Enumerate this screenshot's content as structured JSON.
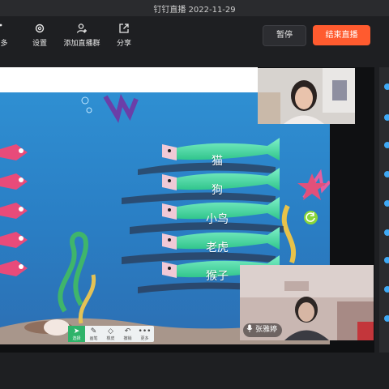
{
  "window": {
    "title": "钉钉直播 2022-11-29"
  },
  "toolbar": {
    "items": [
      {
        "label": "多",
        "icon": "more-icon"
      },
      {
        "label": "设置",
        "icon": "gear-icon"
      },
      {
        "label": "添加直播群",
        "icon": "add-group-icon"
      },
      {
        "label": "分享",
        "icon": "share-icon"
      }
    ],
    "pause_label": "暂停",
    "end_label": "结束直播",
    "end_color": "#ff5b2f"
  },
  "game": {
    "animals": [
      "猫",
      "狗",
      "小鸟",
      "老虎",
      "猴子"
    ]
  },
  "pen_toolbar": {
    "items": [
      {
        "label": "选择",
        "icon": "cursor-icon"
      },
      {
        "label": "画笔",
        "icon": "pen-icon"
      },
      {
        "label": "橡皮",
        "icon": "eraser-icon"
      },
      {
        "label": "撤销",
        "icon": "undo-icon"
      },
      {
        "label": "更多",
        "icon": "more-dots-icon"
      }
    ]
  },
  "participant": {
    "name": "张雅婷"
  }
}
